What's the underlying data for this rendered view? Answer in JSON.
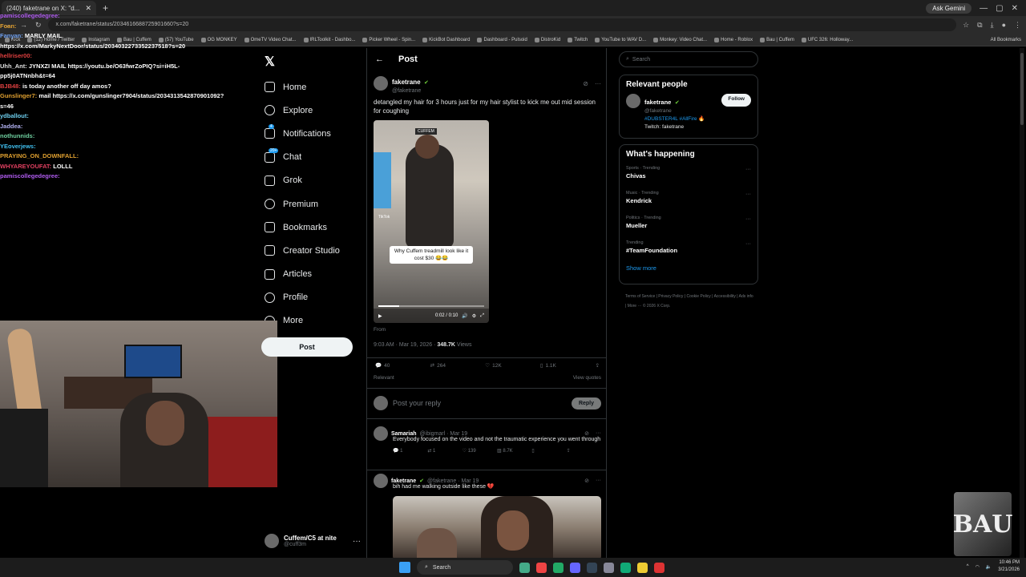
{
  "browser": {
    "tab_title": "(240) faketrane on X: \"d...",
    "address": "x.com/faketrane/status/2034616688725901660?s=20",
    "ask_gemini": "Ask Gemini",
    "bookmarks": [
      "Kick",
      "(12) Home / Twitter",
      "Instagram",
      "Bau | Cuffem",
      "(57) YouTube",
      "OG MONKEY",
      "OmeTV Video Chat...",
      "IRLToolkit - Dashbo...",
      "Picker Wheel - Spin...",
      "KickBot Dashboard",
      "Dashboard - Pulsoid",
      "DistroKid",
      "Twitch",
      "YouTube to WAV D...",
      "Monkey: Video Chat...",
      "Home - Roblox",
      "Bau | Cuffem",
      "UFC 326: Holloway..."
    ],
    "all_bookmarks": "All Bookmarks"
  },
  "chat": [
    {
      "user": "pamiscollegedegree:",
      "msg": "",
      "color": "#b05cf0"
    },
    {
      "user": "Foan:",
      "msg": "",
      "color": "#e0a030"
    },
    {
      "user": "Fanyan:",
      "msg": "MARLY MAIL",
      "color": "#6fa0f0"
    },
    {
      "user": "https://x.com/MarkyNextDoor/status/2034032273352237518?s=20",
      "msg": "",
      "color": "#ffffff"
    },
    {
      "user": "hellriser00:",
      "msg": "",
      "color": "#e04040"
    },
    {
      "user": "Uhh_Ant:",
      "msg": "JYNXZI MAIL https://youtu.be/O63fwrZoPIQ?si=iH5L-",
      "color": "#e0e0e0"
    },
    {
      "user": "pp5j0ATNnbh&t=64",
      "msg": "",
      "color": "#ffffff"
    },
    {
      "user": "BJB48:",
      "msg": "is today another off day amos?",
      "color": "#e04040"
    },
    {
      "user": "Gunslinger7:",
      "msg": "mail https://x.com/gunslinger7904/status/2034313542870901092?",
      "color": "#e0a030"
    },
    {
      "user": "s=46",
      "msg": "",
      "color": "#ffffff"
    },
    {
      "user": "ydballout:",
      "msg": "",
      "color": "#6fd0f0"
    },
    {
      "user": "Jaddea:",
      "msg": "",
      "color": "#b0b0f0"
    },
    {
      "user": "nothunnids:",
      "msg": "",
      "color": "#6fd0a0"
    },
    {
      "user": "YEoverjews:",
      "msg": "",
      "color": "#40c0f0"
    },
    {
      "user": "PRAYING_ON_DOWNFALL:",
      "msg": "",
      "color": "#e0a030"
    },
    {
      "user": "WHYAREYOUFAT:",
      "msg": "LOLLL",
      "color": "#e04060"
    },
    {
      "user": "pamiscollegedegree:",
      "msg": "",
      "color": "#b05cf0"
    }
  ],
  "nav": {
    "items": [
      "Home",
      "Explore",
      "Notifications",
      "Chat",
      "Grok",
      "Premium",
      "Bookmarks",
      "Creator Studio",
      "Articles",
      "Profile",
      "More"
    ],
    "notif_badge": "4",
    "chat_badge": "20+",
    "post_label": "Post"
  },
  "account": {
    "name": "Cuffem/C5 at nite",
    "handle": "@cuff3m"
  },
  "main": {
    "header": "Post",
    "author": "faketrane",
    "handle": "@faketrane",
    "text": "detangled my hair for 3 hours just for my hair stylist to kick me out mid session for coughing",
    "video_tag": "CUFFEM",
    "video_caption": "Why Cuffem treadmill look like it cost $30 😂😂",
    "video_tiktok": "TikTok",
    "video_time": "0:02 / 0:10",
    "video_progress": 0.2,
    "from": "From",
    "time": "9:03 AM · Mar 19, 2026 ·",
    "views_count": "348.7K",
    "views_label": "Views",
    "stats": {
      "replies": "40",
      "reposts": "264",
      "likes": "12K",
      "bookmarks": "1.1K"
    },
    "relevant": "Relevant",
    "view_quotes": "View quotes",
    "reply_placeholder": "Post your reply",
    "reply_button": "Reply",
    "replies": [
      {
        "name": "Samariah",
        "handle": "@ibigmarl · Mar 19",
        "text": "Everybody focused on the video and not the traumatic experience you went through",
        "stats": {
          "replies": "1",
          "reposts": "1",
          "likes": "139",
          "views": "8.7K"
        }
      },
      {
        "name": "faketrane",
        "handle": "@faketrane · Mar 19",
        "text": "bih had me walking outside like these 💔"
      }
    ]
  },
  "right": {
    "search_placeholder": "Search",
    "relevant_title": "Relevant people",
    "rp_name": "faketrane",
    "rp_handle": "@faketrane",
    "rp_tags": "#DUBSTER4L #AllFire",
    "rp_bio": "Twitch: faketrane",
    "follow": "Follow",
    "happening_title": "What's happening",
    "trends": [
      {
        "cat": "Sports · Trending",
        "name": "Chivas"
      },
      {
        "cat": "Music · Trending",
        "name": "Kendrick"
      },
      {
        "cat": "Politics · Trending",
        "name": "Mueller"
      },
      {
        "cat": "Trending",
        "name": "#TeamFoundation"
      }
    ],
    "show_more": "Show more",
    "footer": "Terms of Service | Privacy Policy | Cookie Policy | Accessibility | Ads info | More ··· © 2026 X Corp."
  },
  "taskbar": {
    "search": "Search",
    "time": "10:46 PM",
    "date": "3/21/2026"
  },
  "overlay_logo": "BAU"
}
